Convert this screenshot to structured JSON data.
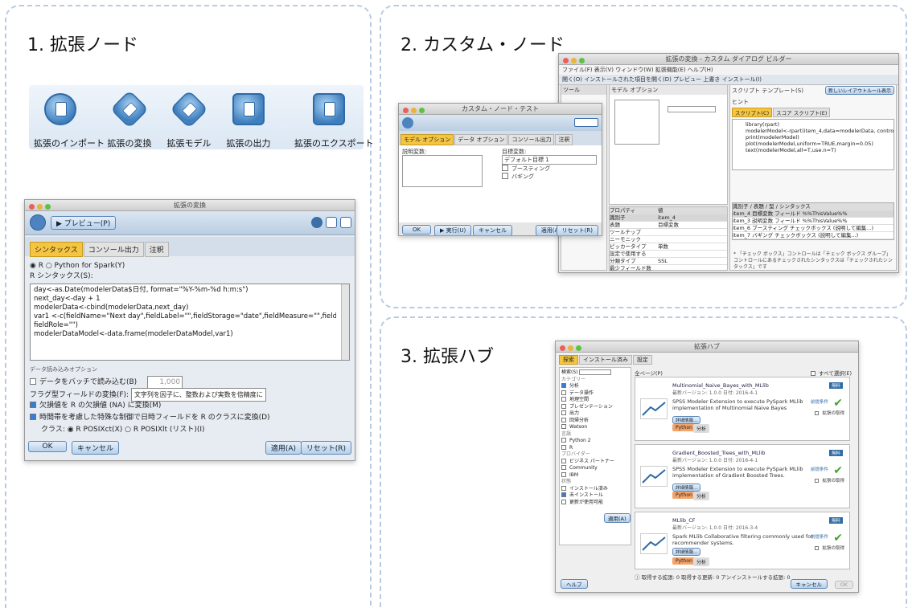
{
  "sections": {
    "s1": {
      "title": "1. 拡張ノード"
    },
    "s2": {
      "title": "2. カスタム・ノード"
    },
    "s3": {
      "title": "3. 拡張ハブ"
    }
  },
  "nodes": [
    {
      "label": "拡張のインポート",
      "icon": "extension-import-icon"
    },
    {
      "label": "拡張の変換",
      "icon": "extension-transform-icon"
    },
    {
      "label": "拡張モデル",
      "icon": "extension-model-icon"
    },
    {
      "label": "拡張の出力",
      "icon": "extension-output-icon"
    },
    {
      "label": "拡張のエクスポート",
      "icon": "extension-export-icon"
    }
  ],
  "transform_window": {
    "title": "拡張の変換",
    "preview_button": "▶ プレビュー(P)",
    "tabs": [
      "シンタックス",
      "コンソール出力",
      "注釈"
    ],
    "radio": "◉ R ○ Python for Spark(Y)",
    "syntax_label": "R シンタックス(S):",
    "code": [
      "day<-as.Date(modelerData$日付, format=\"%Y-%m-%d h:m:s\")",
      "next_day<-day + 1",
      "modelerData<-cbind(modelerData,next_day)",
      "var1 <-c(fieldName=\"Next day\",fieldLabel=\"\",fieldStorage=\"date\",fieldMeasure=\"\",fieldFormat=\"\",",
      "fieldRole=\"\")",
      "modelerDataModel<-data.frame(modelerDataModel,var1)"
    ],
    "options_group": "データ読み込みオプション",
    "batch_label": "データをバッチで読み込む(B)",
    "batch_value": "1,000",
    "flag_label": "フラグ型フィールドの変換(F):",
    "flag_value": "文字列を因子に、整数および実数を倍精度に",
    "missing_label": "欠損値を R の欠損値 (NA) に変換(M)",
    "time_label": "時間帯を考慮した特殊な制御で日時フィールドを R のクラスに変換(D)",
    "class_label": "クラス: ◉ R POSIXct(X) ○ R POSIXlt (リスト)(I)",
    "ok": "OK",
    "cancel": "キャンセル",
    "apply": "適用(A)",
    "reset": "リセット(R)"
  },
  "builder_window": {
    "title": "拡張の変換 - カスタム ダイアログ ビルダー",
    "menu": "ファイル(F) 表示(V) ウィンドウ(W) 拡張機能(E) ヘルプ(H)",
    "toolbar": "開く(O) インストールされた項目を開く(D) プレビュー 上書き インストール(I)",
    "tools_label": "ツール",
    "model_options_tab": "モデル オプション",
    "script_template": "スクリプト テンプレート(S)",
    "new_rule": "新しいレイアウトルール表示",
    "hint": "ヒント",
    "script_tabs": [
      "スクリプト(C)",
      "スコア スクリプト(E)"
    ],
    "script_lines": [
      "library(rpart)",
      "modelerModel<-rpart(item_4,data=modelerData, control = rpart.control(",
      "print(modelerModel)",
      "plot(modelerModel,uniform=TRUE,margin=0.05)",
      "text(modelerModel,all=T,use.n=T)"
    ],
    "props_header": [
      "プロパティ",
      "値"
    ],
    "props": [
      [
        "識別子",
        "item_4"
      ],
      [
        "表題",
        "目標変数"
      ],
      [
        "ツールチップ",
        ""
      ],
      [
        "ニーモニック",
        ""
      ],
      [
        "ピッカータイプ",
        "単数"
      ],
      [
        "設定で使用する",
        ""
      ],
      [
        "分類タイプ",
        "SSL"
      ],
      [
        "最少フィールド数",
        ""
      ],
      [
        "最大フィールド数",
        ""
      ],
      [
        "有効化ルール",
        ""
      ]
    ],
    "id_header": [
      "識別子",
      "表題",
      "型",
      "シンタックス"
    ],
    "id_rows": [
      [
        "item_4",
        "目標変数",
        "フィールド",
        "%%ThisValue%%"
      ],
      [
        "item_3",
        "説明変数",
        "フィールド",
        "%%ThisValue%%"
      ],
      [
        "item_6",
        "ブースティング",
        "チェックボックス",
        "(説明して編集...)"
      ],
      [
        "item_7",
        "バギング",
        "チェックボックス",
        "(説明して編集...)"
      ]
    ],
    "note": "* 「チェック ボックス」コントロールは「チェック ボックス グループ」コントロールにあるチェックされたシンタックスは「チェックされたシンタックス」です"
  },
  "custom_window": {
    "title": "カスタム・ノード・テスト",
    "tabs": [
      "モデル オプション",
      "データ オプション",
      "コンソール出力",
      "注釈"
    ],
    "explanatory": "説明変数:",
    "target": "目標変数:",
    "target_value": "デフォルト目標 1",
    "boosting": "ブースティング",
    "bagging": "バギング",
    "ok": "OK",
    "run": "▶ 実行(U)",
    "cancel": "キャンセル",
    "apply": "適用(A)",
    "reset": "リセット(R)"
  },
  "hub_window": {
    "title": "拡張ハブ",
    "tabs": [
      "探索",
      "インストール済み",
      "設定"
    ],
    "search_label": "検索(S)",
    "filters": [
      "カテゴリー",
      "分析",
      "データ操作",
      "地理空間",
      "プレゼンテーション",
      "出力",
      "回帰分析",
      "Watson",
      "言語",
      "Python 2",
      "R",
      "プロバイダー",
      "ビジネス パートナー",
      "Community",
      "IBM",
      "状態",
      "インストール済み",
      "未インストール",
      "更新が使用可能"
    ],
    "apply_button": "適用(A)",
    "count_label": "全ページ(P)",
    "select_all": "すべて選択(E)",
    "extensions": [
      {
        "name": "Multinomial_Naive_Bayes_with_MLlib",
        "version": "最新バージョン: 1.0.0  日付: 2016-4-1",
        "desc": "SPSS Modeler Extension to execute PySpark MLlib implementation of Multinomial Naive Bayes",
        "tags": [
          "Python 2",
          "分析"
        ]
      },
      {
        "name": "Gradient_Boosted_Trees_with_MLlib",
        "version": "最新バージョン: 1.0.0  日付: 2016-4-1",
        "desc": "SPSS Modeler Extension to execute PySpark MLlib implementation of Gradient Boosted Trees.",
        "tags": [
          "Python 2",
          "分析"
        ]
      },
      {
        "name": "MLlib_CF",
        "version": "最新バージョン: 1.0.0  日付: 2016-3-4",
        "desc": "Spark MLlib Collaborative filtering commonly used for recommender systems.",
        "tags": [
          "Python 2",
          "分析"
        ]
      }
    ],
    "details_button": "詳細情報...",
    "prereq": "前提条件",
    "get_ext": "拡張の取得",
    "free": "無料",
    "status_line": "取得する拡張: 0  取得する更新: 0  アンインストールする拡張: 0",
    "help": "ヘルプ",
    "cancel": "キャンセル",
    "ok": "OK"
  },
  "colors": {
    "accent": "#2f6aa6",
    "tab_active": "#f5c542",
    "panel_border": "#b9cbe0"
  }
}
